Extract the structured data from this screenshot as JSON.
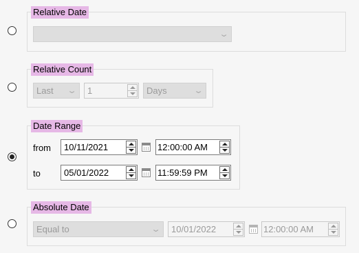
{
  "relative_date": {
    "legend": "Relative Date",
    "value": ""
  },
  "relative_count": {
    "legend": "Relative Count",
    "direction": "Last",
    "count": "1",
    "unit": "Days"
  },
  "date_range": {
    "legend": "Date Range",
    "from_label": "from",
    "from_date": "10/11/2021",
    "from_time": "12:00:00 AM",
    "to_label": "to",
    "to_date": "05/01/2022",
    "to_time": "11:59:59 PM"
  },
  "absolute_date": {
    "legend": "Absolute Date",
    "operator": "Equal to",
    "date": "10/01/2022",
    "time": "12:00:00 AM"
  },
  "selected_option": "date_range",
  "icons": {
    "dropdown": "chevron-down-icon",
    "spinner": "spin-up-down-icon",
    "calendar": "calendar-icon"
  }
}
